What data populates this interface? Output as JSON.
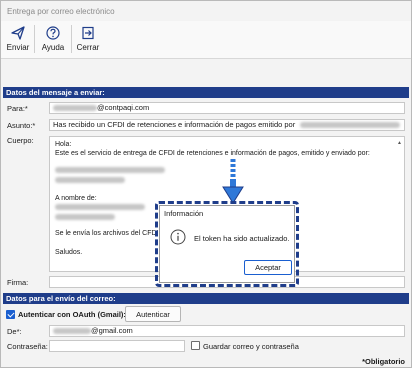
{
  "window": {
    "title": "Entrega por correo electrónico"
  },
  "toolbar": {
    "items": [
      {
        "label": "Enviar",
        "icon": "send-icon"
      },
      {
        "label": "Ayuda",
        "icon": "help-icon"
      },
      {
        "label": "Cerrar",
        "icon": "exit-icon"
      }
    ]
  },
  "message_section": {
    "header": "Datos del mensaje a enviar:",
    "to_label": "Para:*",
    "to_value_suffix": "@contpaqi.com",
    "subject_label": "Asunto:*",
    "subject_value": "Has recibido un CFDI de retenciones e información de pagos emitido por",
    "body_label": "Cuerpo:",
    "body_lines": {
      "greeting": "Hola:",
      "intro": "Este es el servicio de entrega de CFDI de retenciones e información de pagos, emitido y enviado por:",
      "name_of": "A nombre de:",
      "attached": "Se le envía los archivos del CFDI solici",
      "regards": "Saludos."
    },
    "signature_label": "Firma:"
  },
  "send_section": {
    "header": "Datos para el envío del correo:",
    "oauth_label": "Autenticar con OAuth (Gmail):",
    "oauth_checked": true,
    "auth_button": "Autenticar",
    "from_label": "De*:",
    "from_value_suffix": "@gmail.com",
    "password_label": "Contraseña:",
    "save_label": "Guardar correo y contraseña",
    "save_checked": false,
    "required_note": "*Obligatorio"
  },
  "dialog": {
    "title": "Información",
    "message": "El token ha sido actualizado.",
    "accept_button": "Aceptar",
    "icon": "info-icon"
  },
  "colors": {
    "section_header": "#1f3d8a",
    "highlight_outline": "#1f3d8a",
    "accent": "#1a5fd0"
  }
}
